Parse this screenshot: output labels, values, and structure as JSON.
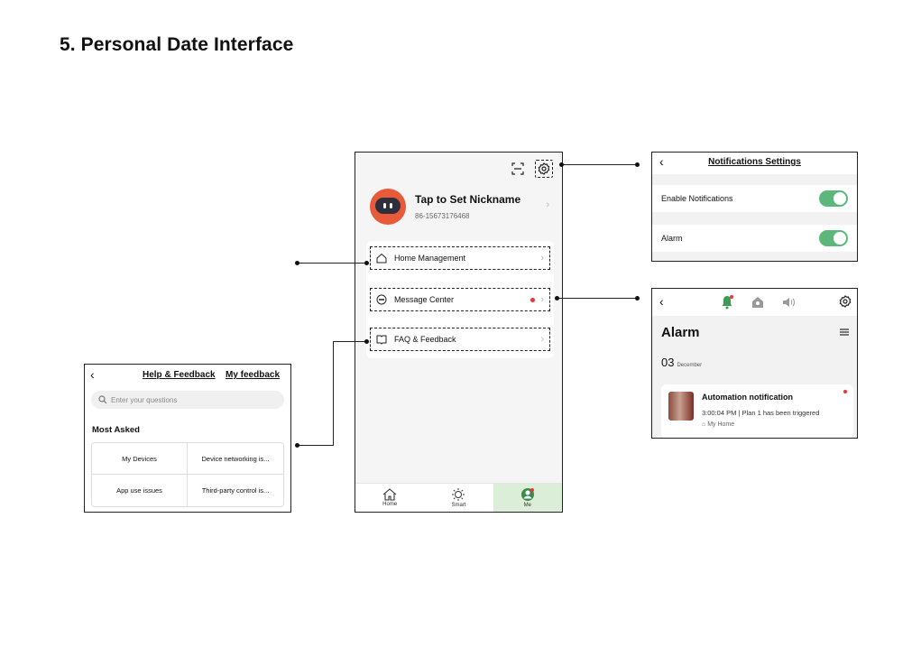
{
  "page": {
    "title": "5.  Personal Date Interface"
  },
  "main_phone": {
    "nickname": "Tap to Set Nickname",
    "phone": "86-15673176468",
    "menu": [
      {
        "label": "Home Management",
        "icon": "home-outline-icon"
      },
      {
        "label": "Message Center",
        "icon": "message-bubble-icon",
        "unread": true
      },
      {
        "label": "FAQ & Feedback",
        "icon": "book-icon"
      }
    ],
    "tabs": [
      {
        "label": "Home",
        "icon": "house-icon"
      },
      {
        "label": "Smart",
        "icon": "sun-icon"
      },
      {
        "label": "Me",
        "icon": "person-icon",
        "active": true
      }
    ]
  },
  "notifications_settings": {
    "title": "Notifications Settings",
    "rows": [
      {
        "label": "Enable Notifications",
        "on": true
      },
      {
        "label": "Alarm",
        "on": true
      }
    ]
  },
  "alarm_screen": {
    "title": "Alarm",
    "day": "03",
    "month": "December",
    "card": {
      "title": "Automation notification",
      "detail": "3:00:04 PM | Plan 1 has been triggered",
      "home": "My Home"
    }
  },
  "help_feedback": {
    "title": "Help & Feedback",
    "my_feedback": "My feedback",
    "search_placeholder": "Enter your questions",
    "section": "Most Asked",
    "items": [
      "My Devices",
      "Device networking is...",
      "App use issues",
      "Third-party control is..."
    ]
  },
  "colors": {
    "toggle_on": "#5bb87a",
    "alert_red": "#e33333",
    "avatar": "#e85a3a",
    "active_tab": "#dbeed7"
  }
}
